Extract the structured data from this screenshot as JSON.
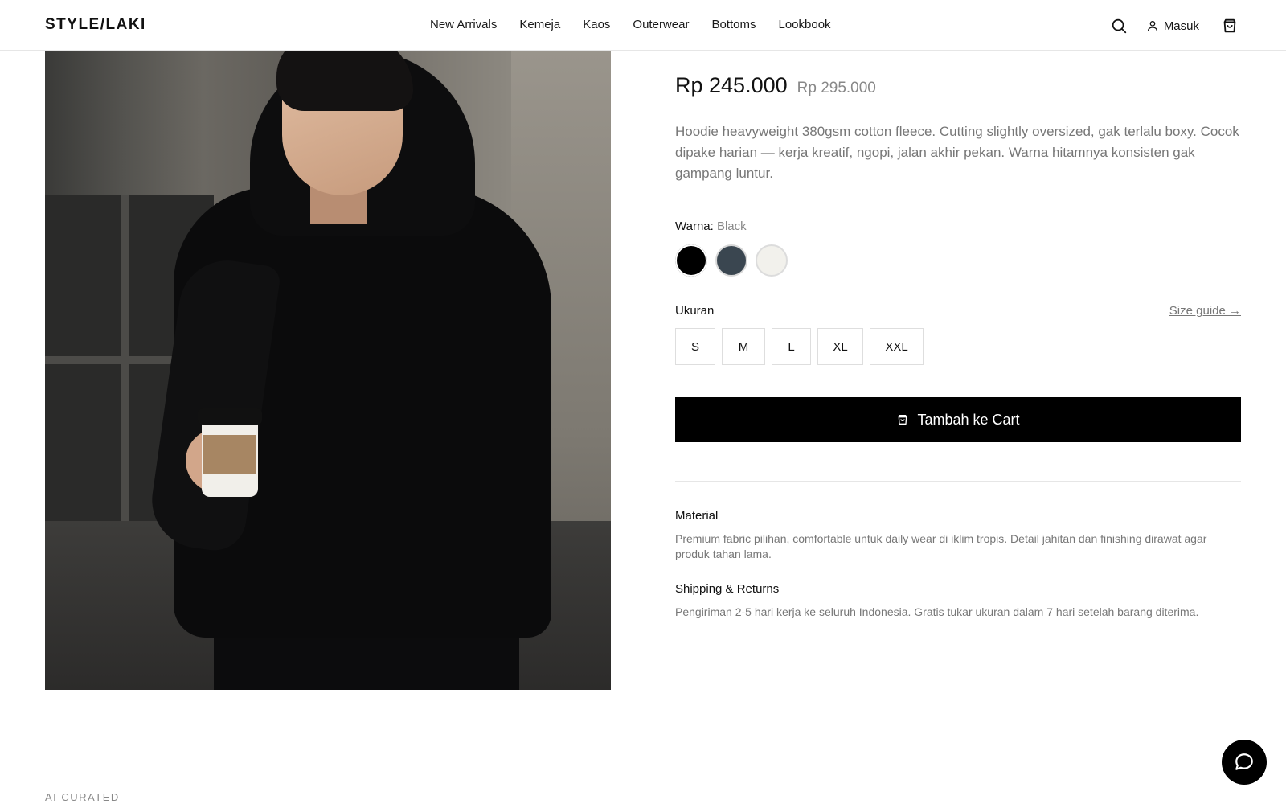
{
  "header": {
    "logo": "STYLE/LAKI",
    "nav": [
      "New Arrivals",
      "Kemeja",
      "Kaos",
      "Outerwear",
      "Bottoms",
      "Lookbook"
    ],
    "login_label": "Masuk",
    "icons": {
      "search": "search-icon",
      "user": "user-icon",
      "cart": "shopping-bag-icon"
    }
  },
  "product": {
    "price": "Rp 245.000",
    "old_price": "Rp 295.000",
    "description": "Hoodie heavyweight 380gsm cotton fleece. Cutting slightly oversized, gak terlalu boxy. Cocok dipake harian — kerja kreatif, ngopi, jalan akhir pekan. Warna hitamnya konsisten gak gampang luntur.",
    "color_label": "Warna:",
    "color_selected": "Black",
    "colors": [
      {
        "name": "Black",
        "hex": "#000000",
        "selected": true
      },
      {
        "name": "Charcoal",
        "hex": "#3a4650",
        "selected": false
      },
      {
        "name": "Off White",
        "hex": "#f2f1ec",
        "selected": false
      }
    ],
    "size_label": "Ukuran",
    "size_guide": "Size guide →",
    "sizes": [
      "S",
      "M",
      "L",
      "XL",
      "XXL"
    ],
    "cta_label": "Tambah ke Cart"
  },
  "details": {
    "material_title": "Material",
    "material_body": "Premium fabric pilihan, comfortable untuk daily wear di iklim tropis. Detail jahitan dan finishing dirawat agar produk tahan lama.",
    "shipping_title": "Shipping & Returns",
    "shipping_body": "Pengiriman 2-5 hari kerja ke seluruh Indonesia. Gratis tukar ukuran dalam 7 hari setelah barang diterima."
  },
  "section_label": "AI CURATED",
  "chat_icon": "chat-bubble-icon"
}
